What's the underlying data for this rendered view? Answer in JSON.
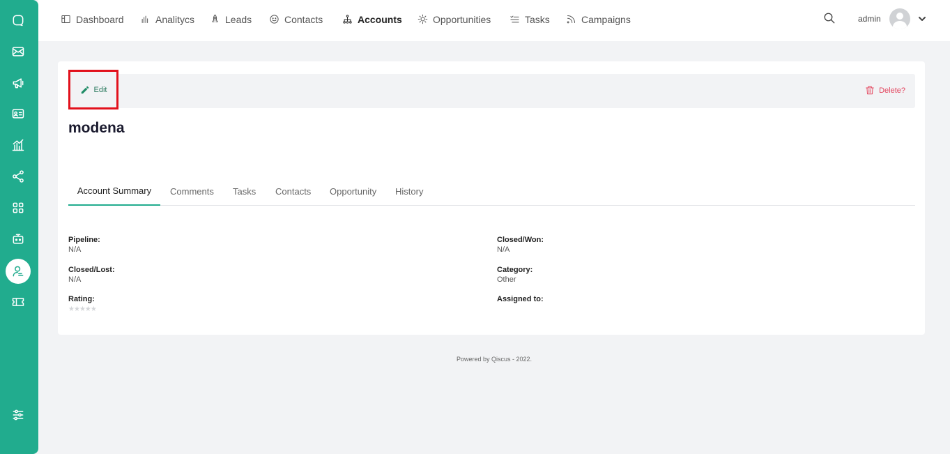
{
  "sidebar": {
    "icons": [
      "chat-icon",
      "mail-icon",
      "megaphone-icon",
      "id-card-icon",
      "analytics-chart-icon",
      "share-nodes-icon",
      "apps-grid-icon",
      "bot-icon",
      "account-person-icon",
      "ticket-icon",
      "settings-sliders-icon"
    ],
    "active": "account-person-icon"
  },
  "nav": {
    "items": [
      {
        "label": "Dashboard",
        "icon": "dashboard-icon"
      },
      {
        "label": "Analitycs",
        "icon": "bar-chart-icon"
      },
      {
        "label": "Leads",
        "icon": "rocket-icon"
      },
      {
        "label": "Contacts",
        "icon": "smile-icon"
      },
      {
        "label": "Accounts",
        "icon": "org-tree-icon"
      },
      {
        "label": "Opportunities",
        "icon": "sun-icon"
      },
      {
        "label": "Tasks",
        "icon": "tasks-list-icon"
      },
      {
        "label": "Campaigns",
        "icon": "rss-icon"
      }
    ],
    "active": "Accounts"
  },
  "user": {
    "name": "admin"
  },
  "actions": {
    "edit_label": "Edit",
    "delete_label": "Delete?"
  },
  "account": {
    "name": "modena"
  },
  "tabs": [
    "Account Summary",
    "Comments",
    "Tasks",
    "Contacts",
    "Opportunity",
    "History"
  ],
  "active_tab": "Account Summary",
  "summary": {
    "pipeline_label": "Pipeline:",
    "pipeline_value": "N/A",
    "closed_won_label": "Closed/Won:",
    "closed_won_value": "N/A",
    "closed_lost_label": "Closed/Lost:",
    "closed_lost_value": "N/A",
    "category_label": "Category:",
    "category_value": "Other",
    "rating_label": "Rating:",
    "rating_value": 0,
    "rating_max": 5,
    "assigned_label": "Assigned to:",
    "assigned_value": ""
  },
  "footer": {
    "text": "Powered by Qiscus - 2022."
  },
  "colors": {
    "brand": "#21ac8e",
    "delete": "#e3425b",
    "highlight_box": "#e2111c"
  }
}
